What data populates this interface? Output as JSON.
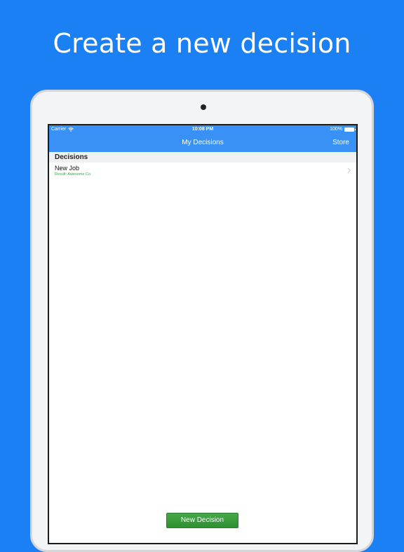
{
  "headline": "Create a new decision",
  "status_bar": {
    "carrier": "Carrier",
    "time": "10:08 PM",
    "battery": "100%"
  },
  "nav": {
    "title": "My Decisions",
    "store_label": "Store"
  },
  "section": {
    "header": "Decisions"
  },
  "decisions": [
    {
      "title": "New Job",
      "subtitle": "Result: Awesome Co."
    }
  ],
  "new_decision_label": "New Decision",
  "colors": {
    "background": "#1a80f4",
    "nav_bar": "#3a91f5",
    "result_text": "#2eaa3c",
    "button": "#3a9e3e"
  },
  "icons": {
    "wifi": "wifi-icon",
    "battery": "battery-icon",
    "chevron": "chevron-right-icon",
    "camera": "camera-icon"
  }
}
